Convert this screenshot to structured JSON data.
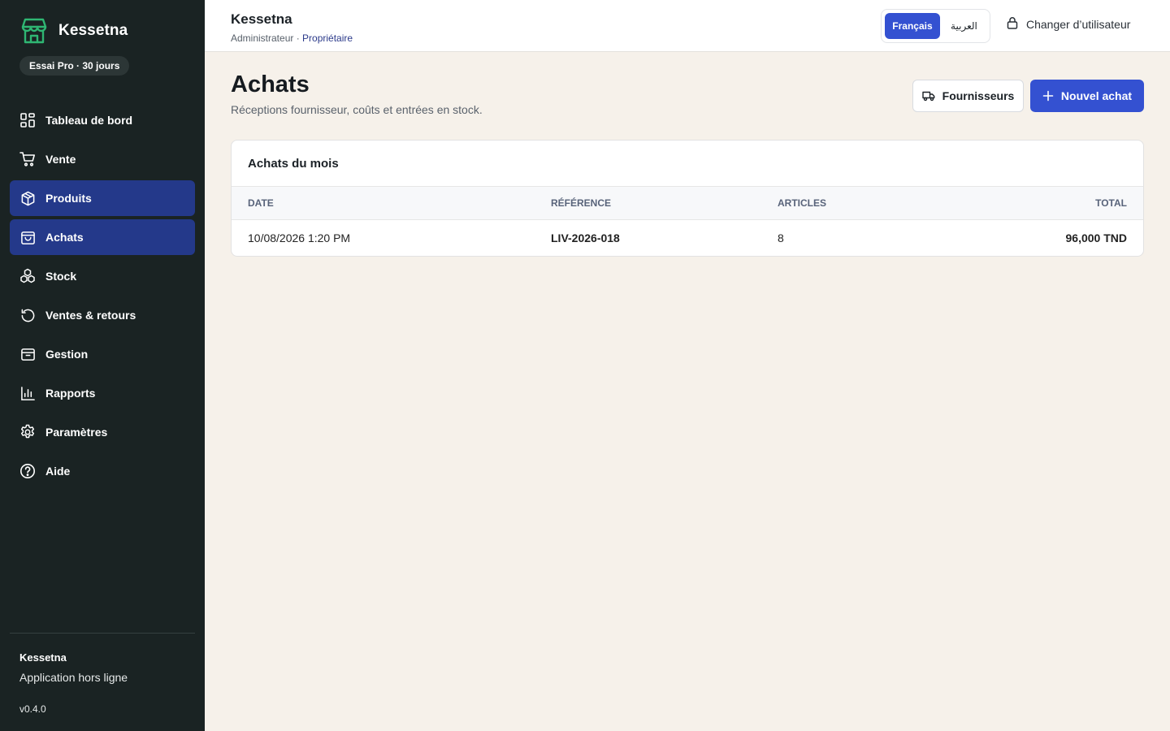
{
  "app": {
    "name": "Kessetna",
    "trial_badge": "Essai Pro · 30 jours"
  },
  "sidebar": {
    "items": [
      {
        "label": "Tableau de bord",
        "icon": "dashboard-icon"
      },
      {
        "label": "Vente",
        "icon": "cart-icon"
      },
      {
        "label": "Produits",
        "icon": "box-icon",
        "active": true
      },
      {
        "label": "Achats",
        "icon": "shopping-bag-icon",
        "active": true
      },
      {
        "label": "Stock",
        "icon": "stock-icon"
      },
      {
        "label": "Ventes & retours",
        "icon": "history-icon"
      },
      {
        "label": "Gestion",
        "icon": "archive-icon"
      },
      {
        "label": "Rapports",
        "icon": "bar-chart-icon"
      },
      {
        "label": "Paramètres",
        "icon": "gear-icon"
      },
      {
        "label": "Aide",
        "icon": "help-icon"
      }
    ],
    "footer": {
      "app_name": "Kessetna",
      "subtitle": "Application hors ligne",
      "version": "v0.4.0"
    }
  },
  "topbar": {
    "title": "Kessetna",
    "role": "Administrateur · ",
    "owner": "Propriétaire",
    "lang_fr": "Français",
    "lang_ar": "العربية",
    "switch_user": "Changer d’utilisateur"
  },
  "page": {
    "title": "Achats",
    "subtitle": "Réceptions fournisseur, coûts et entrées en stock.",
    "suppliers_button": "Fournisseurs",
    "new_button": "Nouvel achat"
  },
  "table": {
    "title": "Achats du mois",
    "headers": {
      "date": "Date",
      "reference": "Référence",
      "articles": "Articles",
      "total": "Total"
    },
    "rows": [
      {
        "date": "10/08/2026 1:20 PM",
        "reference": "LIV-2026-018",
        "articles": "8",
        "total": "96,000 TND"
      }
    ]
  },
  "colors": {
    "sidebar_bg": "#1a2323",
    "active_nav": "#24398a",
    "accent": "#3451d1",
    "brand_green": "#2fb673",
    "page_bg": "#f6f1ea"
  }
}
